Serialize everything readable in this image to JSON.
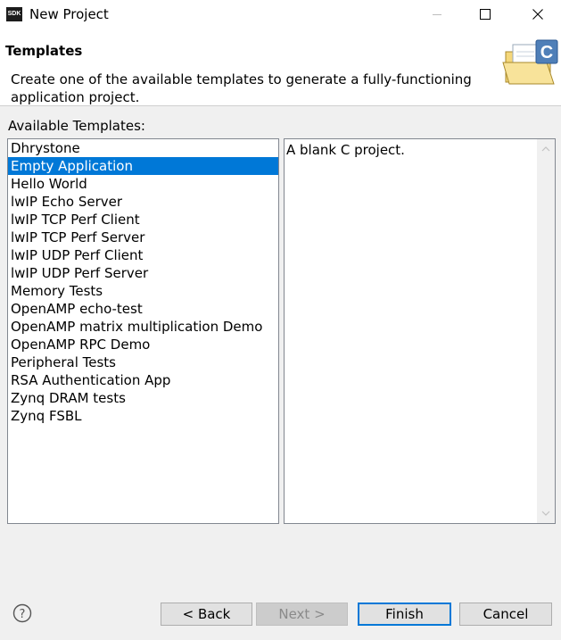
{
  "window": {
    "app_badge": "SDK",
    "title": "New Project"
  },
  "header": {
    "title": "Templates",
    "description": "Create one of the available templates to generate a fully-functioning application project."
  },
  "templates": {
    "label": "Available Templates:",
    "selected_index": 1,
    "items": [
      "Dhrystone",
      "Empty Application",
      "Hello World",
      "lwIP Echo Server",
      "lwIP TCP Perf Client",
      "lwIP TCP Perf Server",
      "lwIP UDP Perf Client",
      "lwIP UDP Perf Server",
      "Memory Tests",
      "OpenAMP echo-test",
      "OpenAMP matrix multiplication Demo",
      "OpenAMP RPC Demo",
      "Peripheral Tests",
      "RSA Authentication App",
      "Zynq DRAM tests",
      "Zynq FSBL"
    ]
  },
  "description_panel": {
    "text": "A blank C project."
  },
  "buttons": {
    "back": "< Back",
    "next": "Next >",
    "finish": "Finish",
    "cancel": "Cancel"
  },
  "icons": {
    "help": "help-icon",
    "wizard": "c-project-folder-icon"
  },
  "colors": {
    "selection": "#0078d7",
    "default_button_border": "#0078d7"
  }
}
